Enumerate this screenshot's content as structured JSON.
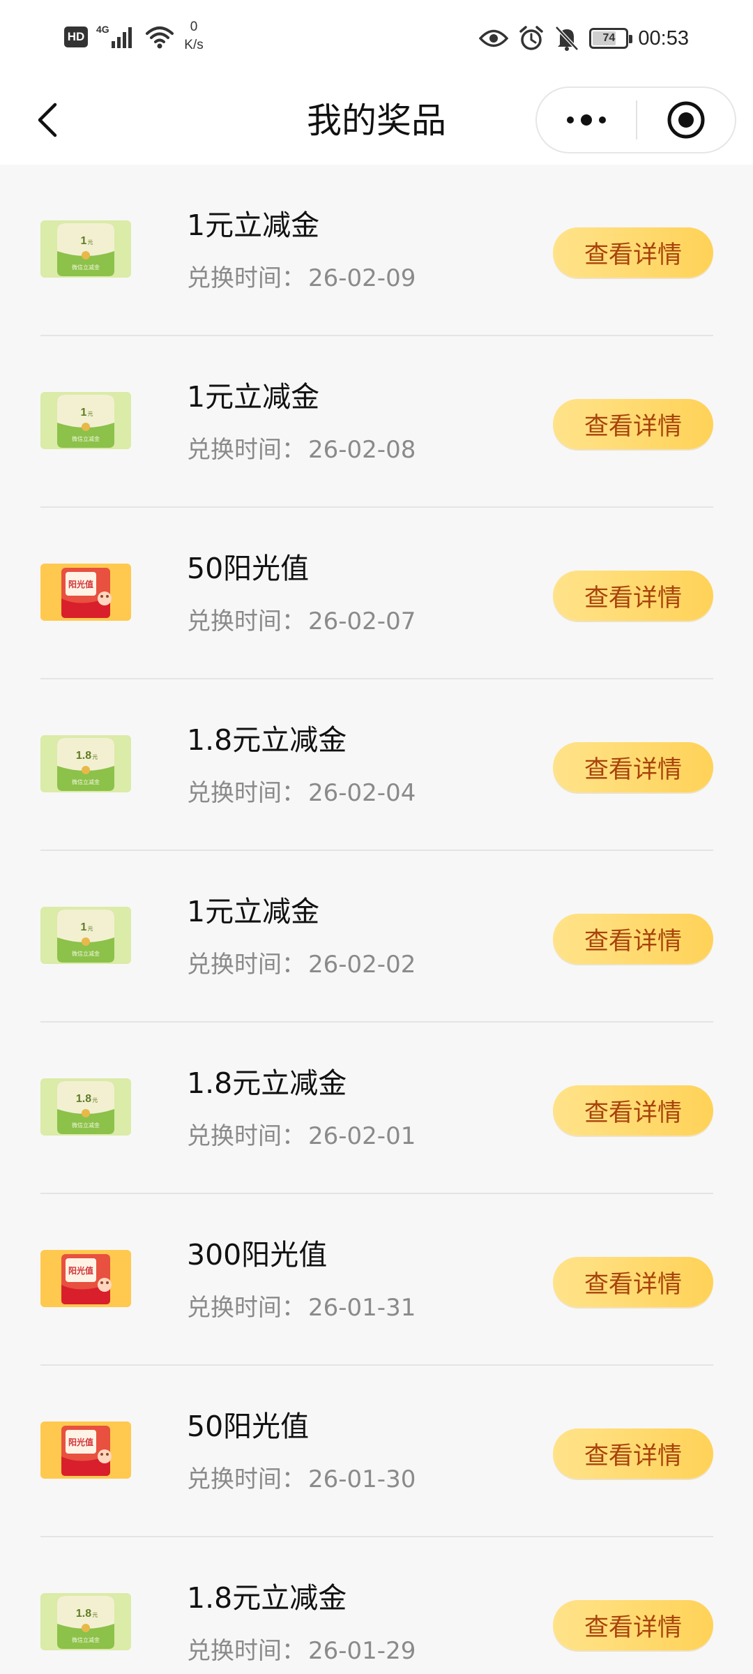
{
  "status_bar": {
    "hd": "HD",
    "net_type": "4G",
    "speed_value": "0",
    "speed_unit": "K/s",
    "battery": "74",
    "time": "00:53"
  },
  "nav": {
    "title": "我的奖品"
  },
  "list": {
    "time_label": "兑换时间：",
    "detail_label": "查看详情"
  },
  "items": [
    {
      "name": "1元立减金",
      "time": "26-02-09",
      "type": "coupon",
      "amount": "1"
    },
    {
      "name": "1元立减金",
      "time": "26-02-08",
      "type": "coupon",
      "amount": "1"
    },
    {
      "name": "50阳光值",
      "time": "26-02-07",
      "type": "sunshine",
      "amount": ""
    },
    {
      "name": "1.8元立减金",
      "time": "26-02-04",
      "type": "coupon",
      "amount": "1.8"
    },
    {
      "name": "1元立减金",
      "time": "26-02-02",
      "type": "coupon",
      "amount": "1"
    },
    {
      "name": "1.8元立减金",
      "time": "26-02-01",
      "type": "coupon",
      "amount": "1.8"
    },
    {
      "name": "300阳光值",
      "time": "26-01-31",
      "type": "sunshine",
      "amount": ""
    },
    {
      "name": "50阳光值",
      "time": "26-01-30",
      "type": "sunshine",
      "amount": ""
    },
    {
      "name": "1.8元立减金",
      "time": "26-01-29",
      "type": "coupon",
      "amount": "1.8"
    }
  ],
  "thumb_text": {
    "coupon_unit": "元",
    "coupon_caption": "微信立减金",
    "sunshine_caption": "阳光值"
  },
  "colors": {
    "button_bg": "#ffd866",
    "button_text": "#a8430c",
    "coupon_green": "#8cc14a",
    "sunshine_orange": "#ffc64a"
  }
}
